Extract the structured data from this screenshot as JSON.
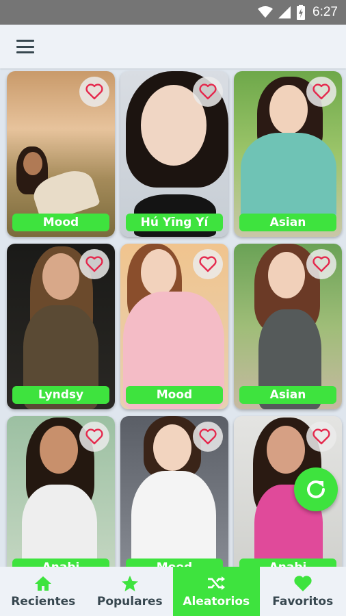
{
  "status_bar": {
    "time": "6:27"
  },
  "app_bar": {
    "menu_icon": "hamburger-menu-icon"
  },
  "colors": {
    "accent": "#3ee33e",
    "nav_text": "#37474f",
    "background": "#dfe6ee"
  },
  "cards": [
    {
      "name": "Mood"
    },
    {
      "name": "Hú Yīng Yí"
    },
    {
      "name": "Asian"
    },
    {
      "name": "Lyndsy"
    },
    {
      "name": "Mood"
    },
    {
      "name": "Asian"
    },
    {
      "name": "Anabi"
    },
    {
      "name": "Mood"
    },
    {
      "name": "Anabi"
    }
  ],
  "fab": {
    "icon": "refresh-icon"
  },
  "bottom_nav": [
    {
      "label": "Recientes",
      "icon": "home-icon"
    },
    {
      "label": "Populares",
      "icon": "star-icon"
    },
    {
      "label": "Aleatorios",
      "icon": "shuffle-icon",
      "active": true
    },
    {
      "label": "Favoritos",
      "icon": "heart-icon"
    }
  ]
}
